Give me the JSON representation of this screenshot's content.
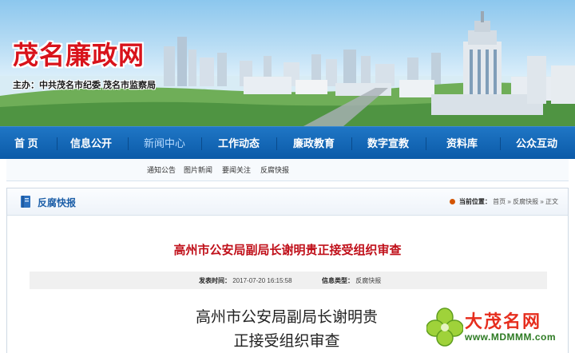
{
  "site": {
    "title": "茂名廉政网",
    "subtitle": "主办：中共茂名市纪委  茂名市监察局"
  },
  "nav": {
    "items": [
      {
        "label": "首 页"
      },
      {
        "label": "信息公开"
      },
      {
        "label": "新闻中心",
        "active": true
      },
      {
        "label": "工作动态"
      },
      {
        "label": "廉政教育"
      },
      {
        "label": "数字宣教"
      },
      {
        "label": "资料库"
      },
      {
        "label": "公众互动"
      }
    ],
    "subitems": [
      "通知公告",
      "图片新闻",
      "要闻关注",
      "反腐快报"
    ]
  },
  "section": {
    "title": "反腐快报",
    "breadcrumb": {
      "label": "当前位置：",
      "items": [
        "首页",
        "反腐快报",
        "正文"
      ],
      "separator": "»"
    }
  },
  "article": {
    "title": "高州市公安局副局长谢明贵正接受组织审查",
    "published_label": "发表时间：",
    "published_value": "2017-07-20 16:15:58",
    "type_label": "信息类型：",
    "type_value": "反腐快报",
    "body_lines": [
      "高州市公安局副局长谢明贵",
      "正接受组织审查"
    ]
  },
  "watermark": {
    "name": "大茂名网",
    "url": "www.MDMMM.com"
  },
  "colors": {
    "brand_red": "#d8131b",
    "nav_blue": "#0b5aa8",
    "section_blue": "#1d5fa8",
    "title_red": "#c0101a"
  }
}
